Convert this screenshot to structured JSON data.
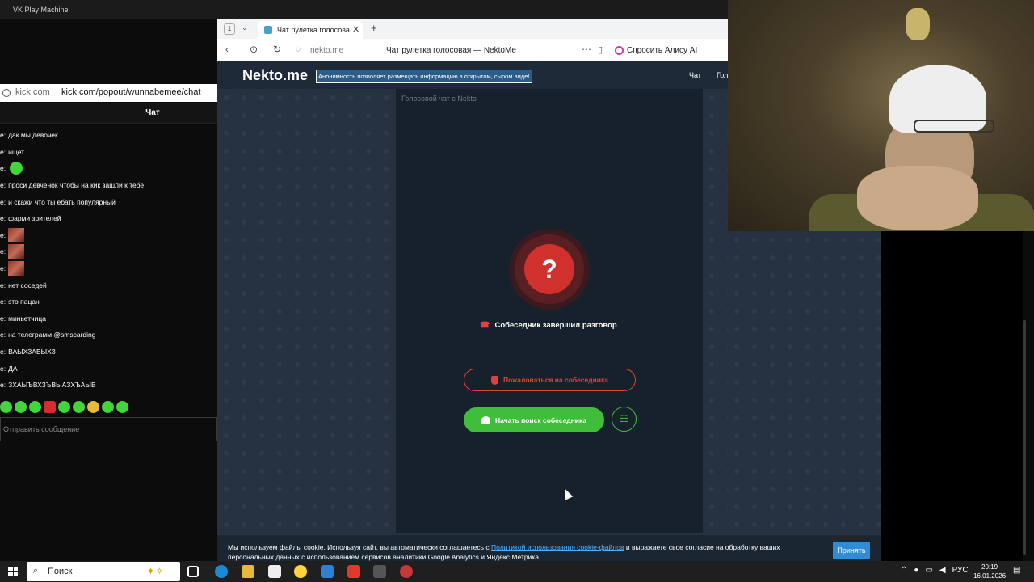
{
  "vk_title": "VK Play Machine",
  "kick": {
    "url_domain": "kick.com",
    "url_path": "kick.com/popout/wunnabemee/chat",
    "header": "Чат",
    "messages": [
      {
        "prefix": "е:",
        "text": "дак мы девочек"
      },
      {
        "prefix": "е:",
        "text": "ищет"
      },
      {
        "prefix": "е:",
        "text": ""
      },
      {
        "prefix": "е:",
        "text": "проси девченок чтобы на кик зашли к тебе"
      },
      {
        "prefix": "е:",
        "text": "и скажи что ты ебать популярный"
      },
      {
        "prefix": "е:",
        "text": "фарми зрителей"
      },
      {
        "prefix": "е:",
        "text": ""
      },
      {
        "prefix": "е:",
        "text": ""
      },
      {
        "prefix": "е:",
        "text": ""
      },
      {
        "prefix": "е:",
        "text": "нет соседей"
      },
      {
        "prefix": "е:",
        "text": "это пацан"
      },
      {
        "prefix": "е:",
        "text": "миньетчица"
      },
      {
        "prefix": "е:",
        "text": "на телеграмм @smscarding"
      },
      {
        "prefix": "е:",
        "text": "ВАЫХЗАВЫХЗ"
      },
      {
        "prefix": "е:",
        "text": "ДА"
      },
      {
        "prefix": "е:",
        "text": "ЗХАЫЪВХЗЪВЫАЗХЪАЫВ"
      }
    ],
    "input_placeholder": "Отправить сообщение"
  },
  "browser": {
    "tab_count": "1",
    "tab_title": "Чат рулетка голосовая",
    "address_domain": "nekto.me",
    "page_title": "Чат рулетка голосовая — NektoMe",
    "alice_label": "Спросить Алису AI"
  },
  "site": {
    "logo": "Nekto.me",
    "banner": "Анонимность позволяет размещать информацию в открытом, сыром виде!",
    "nav_chat": "Чат",
    "nav_voice": "Гол",
    "panel_title": "Голосовой чат с Nekto",
    "status_icon": "?",
    "status_text": "Собеседник завершил разговор",
    "report_label": "Пожаловаться на собеседника",
    "search_label": "Начать поиск собеседника"
  },
  "cookie": {
    "text_before": "Мы используем файлы cookie. Используя сайт, вы автоматически соглашаетесь с ",
    "link": "Политикой использования cookie-файлов",
    "text_after": " и выражаете свое согласие на обработку ваших персональных данных с использованием сервисов аналитики Google Analytics и Яндекс Метрика.",
    "accept": "Принять"
  },
  "taskbar": {
    "search_label": "Поиск",
    "lang": "РУС",
    "time": "20:19",
    "date": "16.01.2026"
  },
  "colors": {
    "accent_red": "#d0312d",
    "accent_green": "#3fbd3b",
    "site_bg": "#263241",
    "panel_bg": "#17212b"
  }
}
